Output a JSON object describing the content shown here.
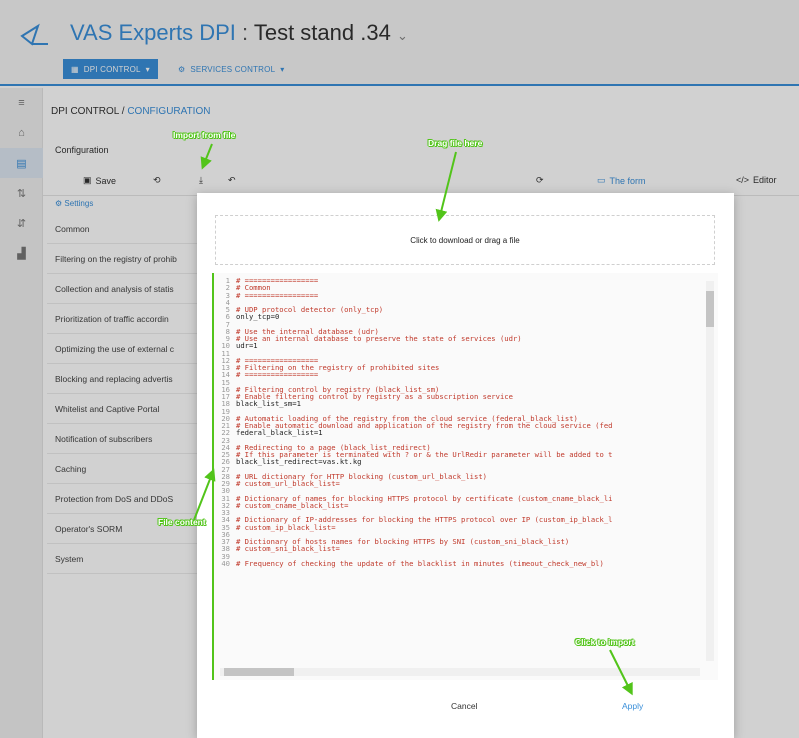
{
  "header": {
    "brand": "VAS Experts DPI",
    "separator": ":",
    "stand": "Test stand .34",
    "stand_caret": "⌄",
    "nav_primary": "DPI CONTROL",
    "nav_primary_caret": "▾",
    "nav_secondary": "SERVICES CONTROL",
    "nav_secondary_caret": "▾"
  },
  "breadcrumb": {
    "section": "DPI CONTROL",
    "separator": "/",
    "page": "CONFIGURATION"
  },
  "config_label": "Configuration",
  "toolbar": {
    "save": "Save",
    "form": "The form",
    "editor": "Editor"
  },
  "settings_label": "Settings",
  "categories": [
    "Common",
    "Filtering on the registry of prohib",
    "Collection and analysis of statis",
    "Prioritization of traffic accordin",
    "Optimizing the use of external c",
    "Blocking and replacing advertis",
    "Whitelist and Captive Portal",
    "Notification of subscribers",
    "Caching",
    "Protection from DoS and DDoS",
    "Operator's SORM",
    "System"
  ],
  "modal": {
    "dropzone_text": "Click to download or drag a file",
    "cancel": "Cancel",
    "apply": "Apply",
    "code_lines": [
      {
        "n": "1",
        "text": "# =================",
        "kind": "comment"
      },
      {
        "n": "2",
        "text": "# Common",
        "kind": "comment"
      },
      {
        "n": "3",
        "text": "# =================",
        "kind": "comment"
      },
      {
        "n": "4",
        "text": "",
        "kind": "setting"
      },
      {
        "n": "5",
        "text": "# UDP protocol detector (only_tcp)",
        "kind": "comment"
      },
      {
        "n": "6",
        "text": "only_tcp=0",
        "kind": "setting"
      },
      {
        "n": "7",
        "text": "",
        "kind": "setting"
      },
      {
        "n": "8",
        "text": "# Use the internal database (udr)",
        "kind": "comment"
      },
      {
        "n": "9",
        "text": "# Use an internal database to preserve the state of services (udr)",
        "kind": "comment"
      },
      {
        "n": "10",
        "text": "udr=1",
        "kind": "setting"
      },
      {
        "n": "11",
        "text": "",
        "kind": "setting"
      },
      {
        "n": "12",
        "text": "# =================",
        "kind": "comment"
      },
      {
        "n": "13",
        "text": "# Filtering on the registry of prohibited sites",
        "kind": "comment"
      },
      {
        "n": "14",
        "text": "# =================",
        "kind": "comment"
      },
      {
        "n": "15",
        "text": "",
        "kind": "setting"
      },
      {
        "n": "16",
        "text": "# Filtering control by registry (black_list_sm)",
        "kind": "comment"
      },
      {
        "n": "17",
        "text": "# Enable filtering control by registry as a subscription service",
        "kind": "comment"
      },
      {
        "n": "18",
        "text": "black_list_sm=1",
        "kind": "setting"
      },
      {
        "n": "19",
        "text": "",
        "kind": "setting"
      },
      {
        "n": "20",
        "text": "# Automatic loading of the registry from the cloud service (federal_black_list)",
        "kind": "comment"
      },
      {
        "n": "21",
        "text": "# Enable automatic download and application of the registry from the cloud service (fed",
        "kind": "comment"
      },
      {
        "n": "22",
        "text": "federal_black_list=1",
        "kind": "setting"
      },
      {
        "n": "23",
        "text": "",
        "kind": "setting"
      },
      {
        "n": "24",
        "text": "# Redirecting to a page (black_list_redirect)",
        "kind": "comment"
      },
      {
        "n": "25",
        "text": "# If this parameter is terminated with ? or & the UrlRedir parameter will be added to t",
        "kind": "comment"
      },
      {
        "n": "26",
        "text": "black_list_redirect=vas.kt.kg",
        "kind": "setting"
      },
      {
        "n": "27",
        "text": "",
        "kind": "setting"
      },
      {
        "n": "28",
        "text": "# URL dictionary for HTTP blocking (custom_url_black_list)",
        "kind": "comment"
      },
      {
        "n": "29",
        "text": "# custom_url_black_list=",
        "kind": "comment"
      },
      {
        "n": "30",
        "text": "",
        "kind": "setting"
      },
      {
        "n": "31",
        "text": "# Dictionary of names for blocking HTTPS protocol by certificate (custom_cname_black_li",
        "kind": "comment"
      },
      {
        "n": "32",
        "text": "# custom_cname_black_list=",
        "kind": "comment"
      },
      {
        "n": "33",
        "text": "",
        "kind": "setting"
      },
      {
        "n": "34",
        "text": "# Dictionary of IP-addresses for blocking the HTTPS protocol over IP (custom_ip_black_l",
        "kind": "comment"
      },
      {
        "n": "35",
        "text": "# custom_ip_black_list=",
        "kind": "comment"
      },
      {
        "n": "36",
        "text": "",
        "kind": "setting"
      },
      {
        "n": "37",
        "text": "# Dictionary of hosts names for blocking HTTPS by SNI (custom_sni_black_list)",
        "kind": "comment"
      },
      {
        "n": "38",
        "text": "# custom_sni_black_list=",
        "kind": "comment"
      },
      {
        "n": "39",
        "text": "",
        "kind": "setting"
      },
      {
        "n": "40",
        "text": "# Frequency of checking the update of the blacklist in minutes (timeout_check_new_bl)",
        "kind": "comment"
      }
    ]
  },
  "annotations": {
    "import_from_file": "Import from file",
    "drag_file_here": "Drag file here",
    "file_content": "File content",
    "click_to_import": "Click to import"
  },
  "colors": {
    "accent": "#3a8fd9",
    "annotation": "#52c41a",
    "comment_text": "#c0392b"
  },
  "icons": [
    "vas-logo-icon",
    "dpi-control-icon",
    "services-control-icon",
    "save-icon",
    "reset-icon",
    "import-icon",
    "undo-icon",
    "refresh-icon",
    "form-icon",
    "editor-icon",
    "settings-icon"
  ]
}
